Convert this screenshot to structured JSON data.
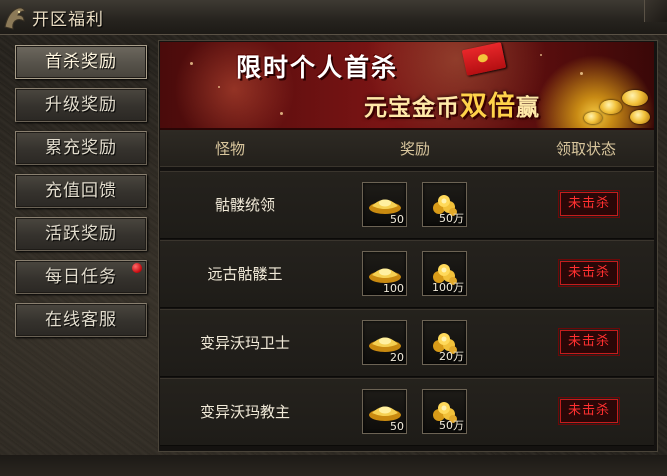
{
  "window": {
    "title": "开区福利"
  },
  "sidebar": {
    "items": [
      {
        "label": "首杀奖励",
        "active": true,
        "badge": false
      },
      {
        "label": "升级奖励",
        "active": false,
        "badge": false
      },
      {
        "label": "累充奖励",
        "active": false,
        "badge": false
      },
      {
        "label": "充值回馈",
        "active": false,
        "badge": false
      },
      {
        "label": "活跃奖励",
        "active": false,
        "badge": false
      },
      {
        "label": "每日任务",
        "active": false,
        "badge": true
      },
      {
        "label": "在线客服",
        "active": false,
        "badge": false
      }
    ]
  },
  "banner": {
    "line1": "限时个人首杀",
    "line2_pre": "元宝金币",
    "line2_big": "双倍",
    "line2_post": "赢"
  },
  "table": {
    "headers": {
      "monster": "怪物",
      "reward": "奖励",
      "status": "领取状态"
    },
    "rows": [
      {
        "monster": "骷髅统领",
        "ingot_count": "50",
        "coin_count": "50万",
        "status": "未击杀"
      },
      {
        "monster": "远古骷髅王",
        "ingot_count": "100",
        "coin_count": "100万",
        "status": "未击杀"
      },
      {
        "monster": "变异沃玛卫士",
        "ingot_count": "20",
        "coin_count": "20万",
        "status": "未击杀"
      },
      {
        "monster": "变异沃玛教主",
        "ingot_count": "50",
        "coin_count": "50万",
        "status": "未击杀"
      }
    ]
  },
  "icons": {
    "ingot": "gold-ingot-icon",
    "coins": "gold-coins-icon",
    "notification": "red-dot-icon"
  },
  "colors": {
    "status_text": "#ff3030",
    "header_text": "#d9c69d",
    "banner_red": "#7a1414",
    "gold": "#f2c13a"
  }
}
